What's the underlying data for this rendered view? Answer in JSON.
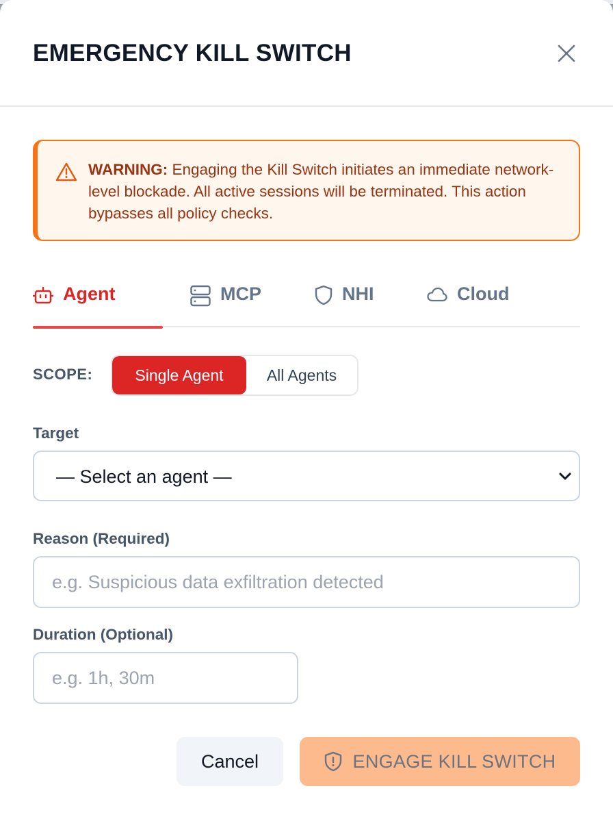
{
  "modal": {
    "title": "EMERGENCY KILL SWITCH",
    "close_icon": "close-icon"
  },
  "warning": {
    "icon": "warning-triangle-icon",
    "label": "WARNING:",
    "text": " Engaging the Kill Switch initiates an immediate network-level blockade. All active sessions will be terminated. This action bypasses all policy checks.",
    "color": "#f97316"
  },
  "tabs": [
    {
      "label": "Agent",
      "icon": "robot-icon",
      "active": true
    },
    {
      "label": "MCP",
      "icon": "server-icon",
      "active": false
    },
    {
      "label": "NHI",
      "icon": "shield-icon",
      "active": false
    },
    {
      "label": "Cloud",
      "icon": "cloud-icon",
      "active": false
    }
  ],
  "scope": {
    "label": "SCOPE:",
    "options": [
      "Single Agent",
      "All Agents"
    ],
    "selected": "Single Agent"
  },
  "target": {
    "label": "Target",
    "value": "— Select an agent —"
  },
  "reason": {
    "label": "Reason (Required)",
    "placeholder": "e.g. Suspicious data exfiltration detected"
  },
  "duration": {
    "label": "Duration (Optional)",
    "placeholder": "e.g. 1h, 30m"
  },
  "actions": {
    "cancel_label": "Cancel",
    "engage_label": "ENGAGE KILL SWITCH",
    "engage_icon": "shield-alert-icon",
    "engage_disabled": true
  },
  "colors": {
    "accent_red": "#dc2626",
    "warning_orange": "#f97316",
    "engage_disabled_bg": "#fdba8c"
  }
}
